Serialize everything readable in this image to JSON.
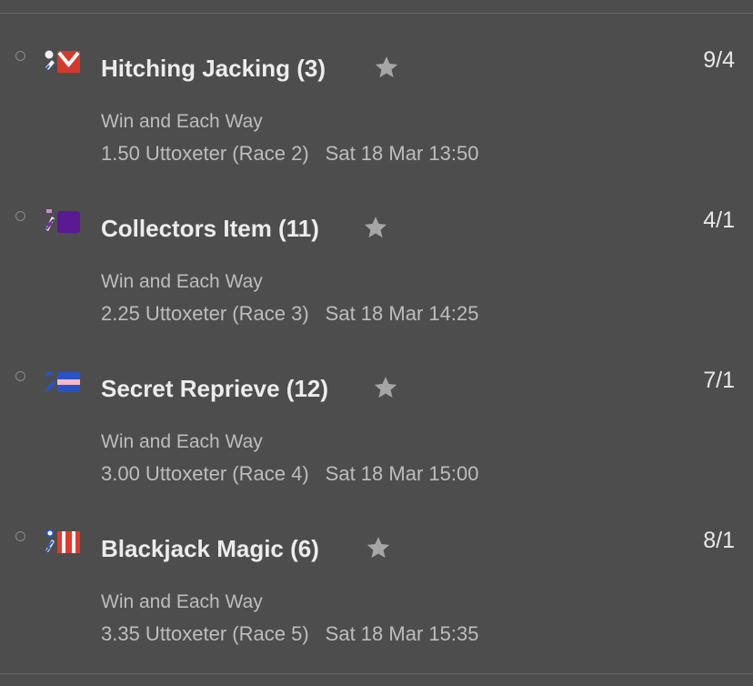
{
  "selections": [
    {
      "horse": "Hitching Jacking (3)",
      "odds": "9/4",
      "market": "Win and Each Way",
      "race": "1.50 Uttoxeter (Race 2)",
      "date": "Sat 18 Mar 13:50",
      "silks_icon": "silks-red-white-chevron-icon"
    },
    {
      "horse": "Collectors Item (11)",
      "odds": "4/1",
      "market": "Win and Each Way",
      "race": "2.25 Uttoxeter (Race 3)",
      "date": "Sat 18 Mar 14:25",
      "silks_icon": "silks-purple-icon"
    },
    {
      "horse": "Secret Reprieve (12)",
      "odds": "7/1",
      "market": "Win and Each Way",
      "race": "3.00 Uttoxeter (Race 4)",
      "date": "Sat 18 Mar 15:00",
      "silks_icon": "silks-blue-pink-hoop-icon"
    },
    {
      "horse": "Blackjack Magic (6)",
      "odds": "8/1",
      "market": "Win and Each Way",
      "race": "3.35 Uttoxeter (Race 5)",
      "date": "Sat 18 Mar 15:35",
      "silks_icon": "silks-red-white-braces-icon"
    }
  ],
  "colors": {
    "background": "#4d4d4d",
    "star": "#a6a6a6"
  }
}
